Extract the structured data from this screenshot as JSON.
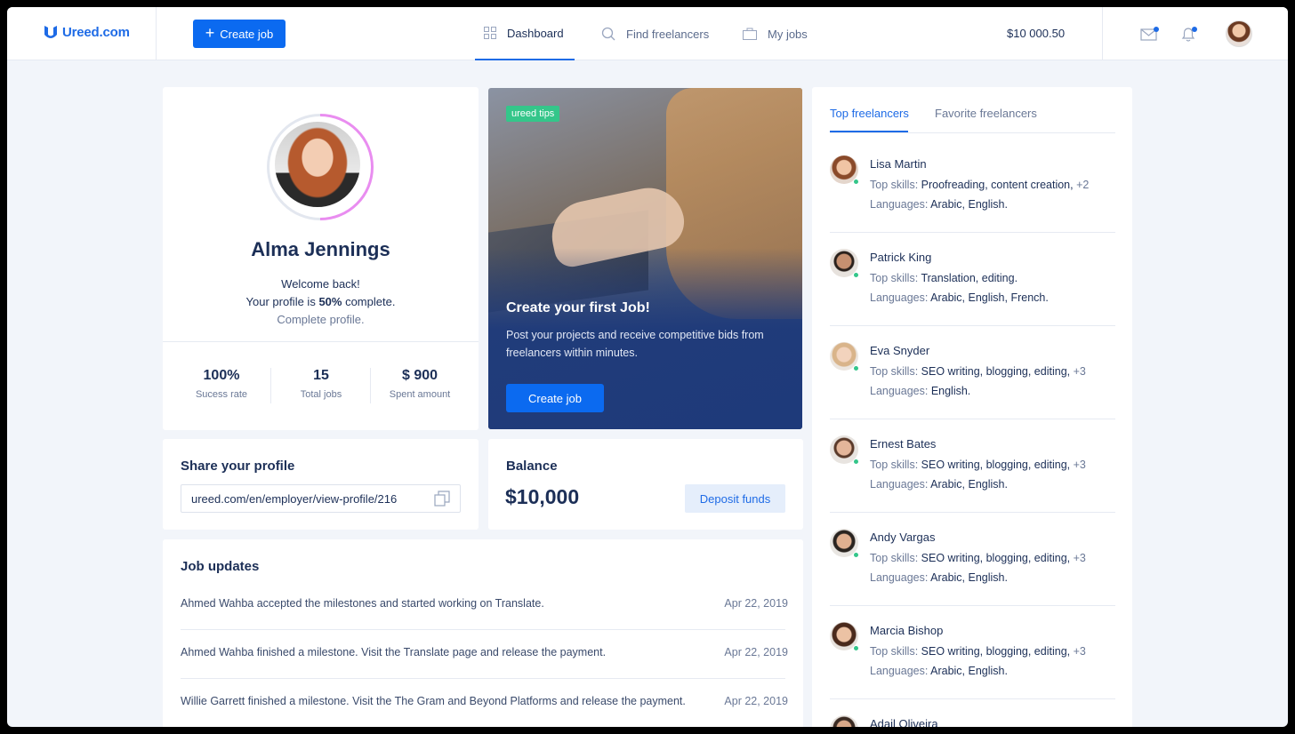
{
  "app": {
    "logo_text": "Ureed.com",
    "brand_color": "#1e6be6"
  },
  "topbar": {
    "create_job_label": "Create job",
    "nav": [
      {
        "label": "Dashboard",
        "icon": "grid-icon",
        "active": true
      },
      {
        "label": "Find freelancers",
        "icon": "search-icon",
        "active": false
      },
      {
        "label": "My jobs",
        "icon": "briefcase-icon",
        "active": false
      }
    ],
    "balance": "$10 000.50"
  },
  "profile": {
    "name": "Alma Jennings",
    "welcome": "Welcome back!",
    "completion_prefix": "Your profile is ",
    "completion_value": "50%",
    "completion_suffix": " complete.",
    "completion_percent": 50,
    "complete_link": "Complete profile.",
    "stats": [
      {
        "value": "100%",
        "label": "Sucess rate"
      },
      {
        "value": "15",
        "label": "Total jobs"
      },
      {
        "value": "$ 900",
        "label": "Spent amount"
      }
    ]
  },
  "tips": {
    "badge": "ureed tips",
    "title": "Create your first Job!",
    "text": "Post your projects and receive competitive bids from freelancers within minutes.",
    "button": "Create job"
  },
  "share": {
    "title": "Share your profile",
    "url": "ureed.com/en/employer/view-profile/216"
  },
  "balance": {
    "title": "Balance",
    "value": "$10,000",
    "button": "Deposit funds"
  },
  "updates": {
    "title": "Job updates",
    "items": [
      {
        "text": "Ahmed Wahba accepted the milestones and started working on Translate.",
        "date": "Apr 22, 2019"
      },
      {
        "text": "Ahmed Wahba finished a milestone. Visit the Translate page and release the payment.",
        "date": "Apr 22, 2019"
      },
      {
        "text": "Willie Garrett finished a milestone. Visit the The Gram and Beyond Platforms and release the payment.",
        "date": "Apr 22, 2019"
      }
    ]
  },
  "freelancers": {
    "tabs": [
      "Top freelancers",
      "Favorite freelancers"
    ],
    "skills_label": "Top skills: ",
    "languages_label": "Languages: ",
    "items": [
      {
        "name": "Lisa Martin",
        "skills": "Proofreading, content creation,",
        "more": " +2",
        "languages": "Arabic, English."
      },
      {
        "name": "Patrick King",
        "skills": "Translation, editing.",
        "more": "",
        "languages": "Arabic, English, French."
      },
      {
        "name": "Eva Snyder",
        "skills": "SEO writing, blogging, editing,",
        "more": " +3",
        "languages": "English."
      },
      {
        "name": "Ernest Bates",
        "skills": "SEO writing, blogging, editing,",
        "more": " +3",
        "languages": "Arabic, English."
      },
      {
        "name": "Andy Vargas",
        "skills": "SEO writing, blogging, editing,",
        "more": " +3",
        "languages": "Arabic, English."
      },
      {
        "name": "Marcia Bishop",
        "skills": "SEO writing, blogging, editing,",
        "more": " +3",
        "languages": "Arabic, English."
      },
      {
        "name": "Adail Oliveira",
        "skills": "",
        "more": "",
        "languages": ""
      }
    ]
  }
}
